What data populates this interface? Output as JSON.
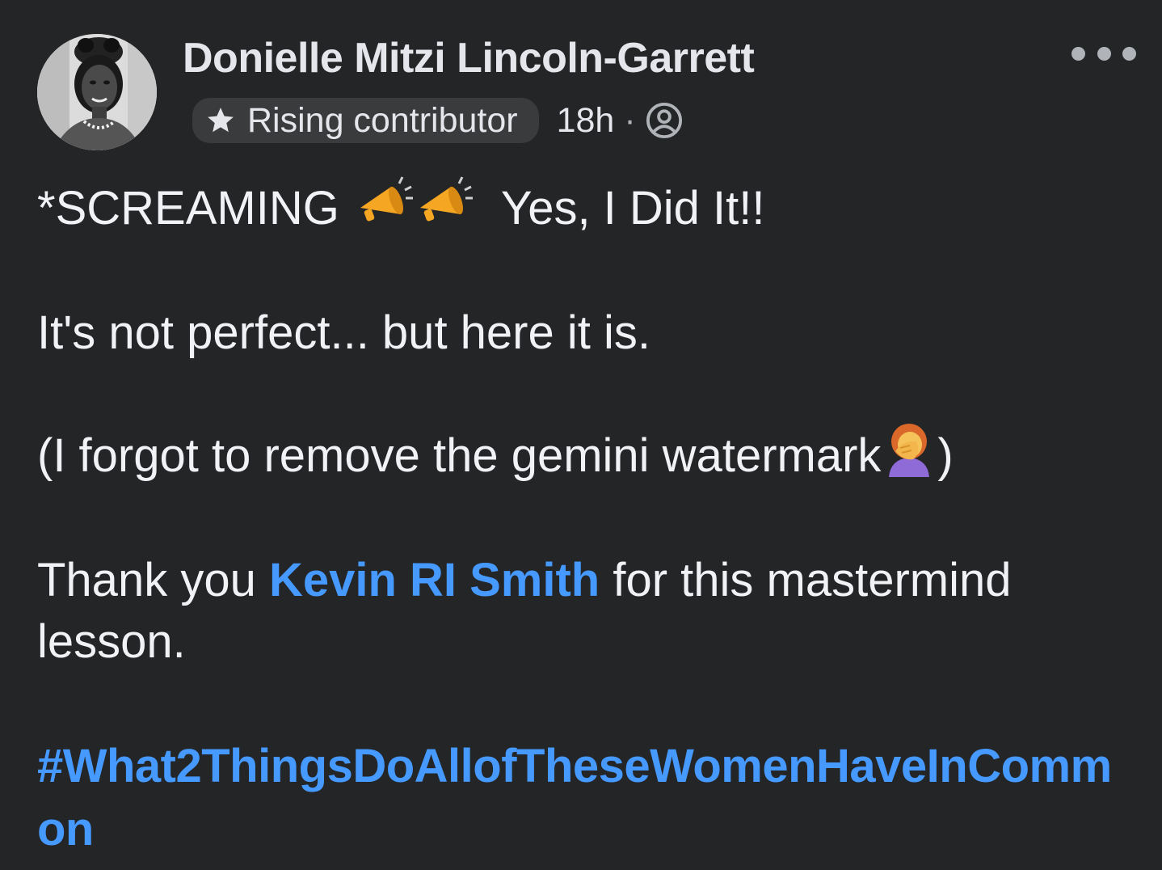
{
  "post": {
    "author": {
      "name": "Donielle Mitzi Lincoln-Garrett",
      "avatar_icon": "profile-photo"
    },
    "badge": {
      "icon": "star-icon",
      "label": "Rising contributor"
    },
    "timestamp": "18h",
    "separator": "·",
    "audience_icon": "group-members-icon",
    "more_icon": "more-options-icon",
    "body": {
      "line1_text": "*SCREAMING",
      "line1_emoji": "megaphone-emoji",
      "line1_suffix": "Yes, I Did It!!",
      "line2": "It's not perfect... but here it is.",
      "line3_text": "(I forgot to remove the gemini watermark",
      "line3_emoji": "woman-facepalming-emoji",
      "line3_close": ")",
      "line4_prefix": "Thank you ",
      "mention": "Kevin RI Smith",
      "line4_suffix": " for this mastermind",
      "line5": "lesson.",
      "hashtag_part1": "#What2ThingsDoAllofTheseWomenHaveInComm",
      "hashtag_part2": "on"
    }
  },
  "colors": {
    "background": "#242527",
    "text": "#e4e6eb",
    "link": "#4599ff",
    "badge_bg": "#3a3b3c"
  }
}
